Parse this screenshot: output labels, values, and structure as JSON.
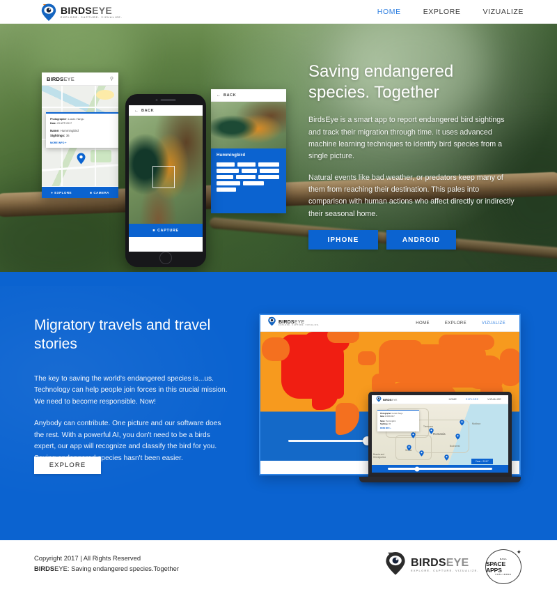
{
  "brand": {
    "name_bold": "BIRDS",
    "name_light": "EYE",
    "tagline": "EXPLORE. CAPTURE. VIZUALIZE.",
    "accent_blue": "#0B63D0",
    "accent_orange": "#F07F1A",
    "logo_icon": "map-pin-eye-icon"
  },
  "topnav": {
    "links": [
      {
        "label": "HOME",
        "active": true
      },
      {
        "label": "EXPLORE",
        "active": false
      },
      {
        "label": "VIZUALIZE",
        "active": false
      }
    ]
  },
  "hero": {
    "title": "Saving endangered species. Together",
    "paragraph1": "BirdsEye is a smart app to report endangered bird sightings and track their migration through time. It uses advanced machine learning techniques to identify bird species from a single picture.",
    "paragraph2": "Natural events like bad weather, or predators keep many of them from reaching their destination. This pales into comparison with human actions who affect directly or indirectly their seasonal home.",
    "buttons": [
      {
        "label": "IPHONE"
      },
      {
        "label": "ANDROID"
      }
    ],
    "map_card": {
      "logo_bold": "BIRDS",
      "logo_light": "EYE",
      "search_icon": "search-icon",
      "info": {
        "photographer_label": "Photographer:",
        "photographer_value": "Lucian Vlangu",
        "date_label": "Date:",
        "date_value": "29 APR 2017",
        "name_label": "Name:",
        "name_value": "Hummingbird",
        "sightings_label": "Sightings:",
        "sightings_value": "36",
        "more_info": "MORE INFO +"
      },
      "actions": [
        {
          "label": "EXPLORE",
          "icon": "pin-icon"
        },
        {
          "label": "CAMERA",
          "icon": "camera-icon"
        }
      ]
    },
    "phone": {
      "back_label": "BACK",
      "capture_label": "CAPTURE"
    },
    "detail_card": {
      "back_label": "BACK",
      "species_title": "Hummingbird"
    }
  },
  "migratory": {
    "title": "Migratory travels and travel stories",
    "paragraph1": "The key to saving the world's endangered species is...us. Technology can help people join forces in this crucial mission. We need to become responsible. Now!",
    "paragraph2": "Anybody can contribute. One picture and our software does the rest. With a powerful AI, you don't need to be a birds expert, our app will recognize and classify the bird for you. Saving endangered species hasn't been easier.",
    "cta_label": "EXPLORE",
    "browser": {
      "logo_bold": "BIRDS",
      "logo_light": "EYE",
      "tagline": "EXPLORE. CAPTURE. VIZUALIZE.",
      "links": [
        {
          "label": "HOME",
          "active": false
        },
        {
          "label": "EXPLORE",
          "active": false
        },
        {
          "label": "VIZUALIZE",
          "active": true
        }
      ]
    },
    "laptop": {
      "logo_bold": "BIRDS",
      "logo_light": "EYE",
      "links": [
        {
          "label": "HOME",
          "active": false
        },
        {
          "label": "EXPLORE",
          "active": true
        },
        {
          "label": "VIZUALIZE",
          "active": false
        }
      ],
      "map_labels": [
        "Romania",
        "Serbia",
        "Moldova",
        "Bucharest",
        "Timisoara",
        "Bosnia and Herzegovina",
        "Hungary"
      ],
      "card": {
        "photographer_label": "Photographer:",
        "photographer_value": "Lucian Vlangu",
        "date_label": "Date:",
        "date_value": "29 APR 2017",
        "name_label": "Name:",
        "name_value": "Hummingbird",
        "sightings_label": "Sightings:",
        "sightings_value": "36",
        "more_info": "MORE INFO +"
      },
      "year_badge": "Year: 2017"
    }
  },
  "footer": {
    "copyright": "Copyright 2017 | All Rights Reserved",
    "tagline_bold": "BIRDS",
    "tagline_rest": "EYE: Saving endangered species.Together",
    "logo_bold": "BIRDS",
    "logo_light": "EYE",
    "logo_tagline": "EXPLORE. CAPTURE. VIZUALIZE.",
    "badge": {
      "top": "NASA",
      "main": "SPACE APPS",
      "bottom": "CHALLENGE"
    }
  }
}
